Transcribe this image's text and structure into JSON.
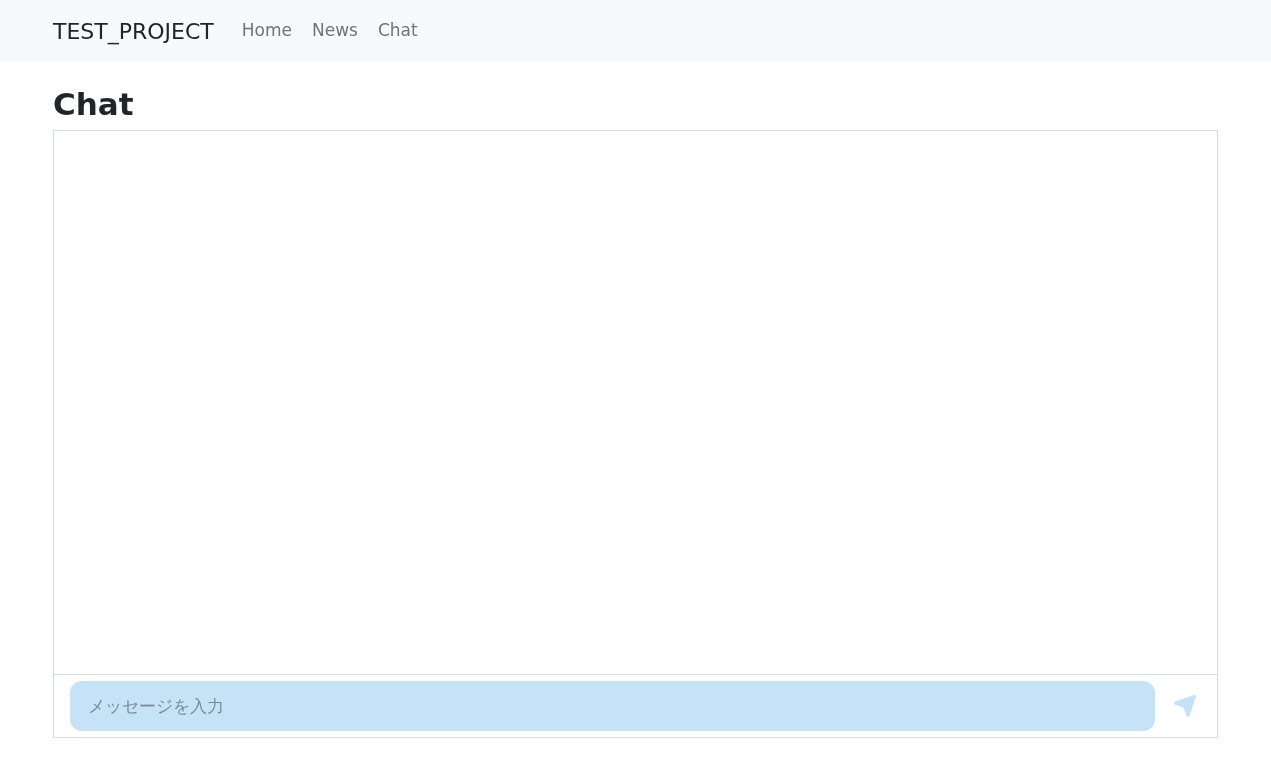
{
  "navbar": {
    "brand": "TEST_PROJECT",
    "links": [
      "Home",
      "News",
      "Chat"
    ]
  },
  "page_title": "Chat",
  "chat": {
    "input": {
      "placeholder": "メッセージを入力"
    }
  }
}
